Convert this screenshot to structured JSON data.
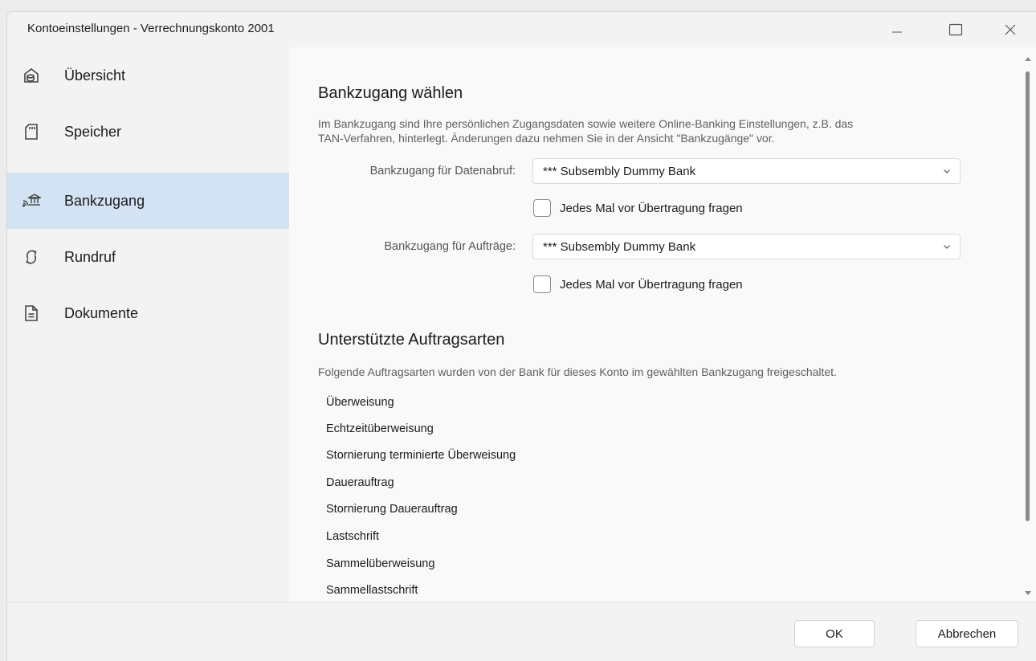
{
  "window": {
    "title": "Kontoeinstellungen - Verrechnungskonto 2001",
    "minimize_glyph": "—",
    "maximize_glyph": "☐",
    "close_glyph": "✕"
  },
  "sidebar": {
    "items": [
      {
        "label": "Übersicht",
        "icon": "overview-icon",
        "active": false
      },
      {
        "label": "Speicher",
        "icon": "storage-card-icon",
        "active": false
      },
      {
        "label": "Bankzugang",
        "icon": "bank-access-icon",
        "active": true
      },
      {
        "label": "Rundruf",
        "icon": "refresh-icon",
        "active": false
      },
      {
        "label": "Dokumente",
        "icon": "document-icon",
        "active": false
      }
    ]
  },
  "bank_access": {
    "title": "Bankzugang wählen",
    "description_line1": "Im Bankzugang sind Ihre persönlichen Zugangsdaten sowie weitere Online-Banking Einstellungen, z.B. das",
    "description_line2": "TAN-Verfahren, hinterlegt. Änderungen dazu nehmen Sie in der Ansicht \"Bankzugänge\" vor.",
    "data_retrieval_label": "Bankzugang für Datenabruf:",
    "data_retrieval_value": "*** Subsembly Dummy Bank",
    "data_retrieval_ask_label": "Jedes Mal vor Übertragung fragen",
    "orders_label": "Bankzugang für Aufträge:",
    "orders_value": "*** Subsembly Dummy Bank",
    "orders_ask_label": "Jedes Mal vor Übertragung fragen"
  },
  "order_types": {
    "title": "Unterstützte Auftragsarten",
    "description": "Folgende Auftragsarten wurden von der Bank für dieses Konto im gewählten Bankzugang freigeschaltet.",
    "items": [
      "Überweisung",
      "Echtzeitüberweisung",
      "Stornierung terminierte Überweisung",
      "Dauerauftrag",
      "Stornierung Dauerauftrag",
      "Lastschrift",
      "Sammelüberweisung",
      "Sammellastschrift"
    ]
  },
  "footer": {
    "ok_label": "OK",
    "cancel_label": "Abbrechen"
  },
  "colors": {
    "active_nav": "#d3e3f3",
    "content_bg": "#f9f9f9",
    "sidebar_bg": "#f3f3f3"
  }
}
